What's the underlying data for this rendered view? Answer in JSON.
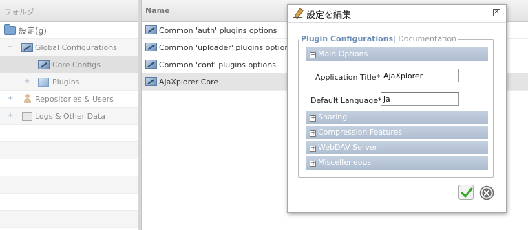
{
  "left_panel": {
    "header": "フォルダ",
    "tree": {
      "root_label": "設定(g)",
      "global_configurations": "Global Configurations",
      "core_configs": "Core Configs",
      "plugins": "Plugins",
      "repositories_users": "Repositories & Users",
      "logs_other_data": "Logs & Other Data"
    }
  },
  "right_panel": {
    "header": "Name",
    "rows": [
      "Common 'auth' plugins options",
      "Common 'uploader' plugins options",
      "Common 'conf' plugins options",
      "AjaXplorer Core"
    ]
  },
  "dialog": {
    "title": "設定を編集",
    "close_glyph": "✕",
    "legend_active": "Plugin Configurations",
    "legend_separator": "|",
    "legend_doc": "Documentation",
    "main_options": "Main Options",
    "app_title_label": "Application Title* :",
    "app_title_value": "AjaXplorer",
    "default_language_label": "Default Language* :",
    "default_language_value": "ja",
    "sections": [
      "Sharing",
      "Compression Features",
      "WebDAV Server",
      "Miscelleneous"
    ],
    "expand_glyph": "+",
    "collapse_glyph": "−"
  },
  "colors": {
    "section_bar": "#b7c6d8",
    "legend_accent": "#6a8eb8",
    "ok_green": "#3aa82a",
    "cancel_gray": "#6a6a6a"
  },
  "icons": {
    "root": "folder-icon",
    "config": "config-wrench-icon",
    "plugins": "plugin-icon",
    "users": "user-icon",
    "logs": "logs-icon",
    "dialog": "pencil-icon",
    "ok": "checkmark-icon",
    "cancel": "cancel-circle-icon"
  }
}
